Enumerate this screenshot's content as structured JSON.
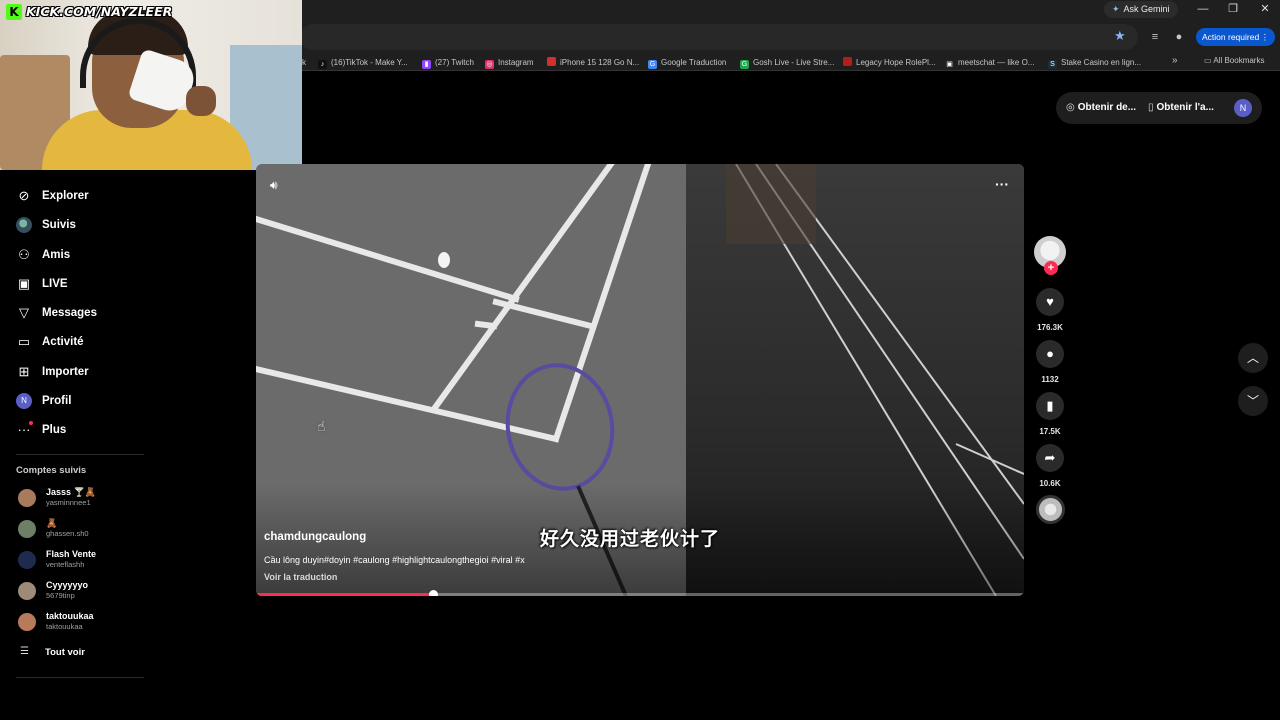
{
  "browser": {
    "gemini_label": "Ask Gemini",
    "action_required": "Action required",
    "bookmarks": [
      {
        "label": "k",
        "color": "#444444",
        "icon": ""
      },
      {
        "label": "(16)TikTok - Make Y...",
        "color": "#111111",
        "icon": "tiktok-icon"
      },
      {
        "label": "(27) Twitch",
        "color": "#9146ff",
        "icon": "twitch-icon"
      },
      {
        "label": "Instagram",
        "color": "#e1306c",
        "icon": "instagram-icon"
      },
      {
        "label": "iPhone 15 128 Go N...",
        "color": "#d32f2f",
        "icon": "apple-icon"
      },
      {
        "label": "Google Traduction",
        "color": "#4285f4",
        "icon": "translate-icon"
      },
      {
        "label": "Gosh Live - Live Stre...",
        "color": "#1ea84b",
        "icon": "gosh-icon"
      },
      {
        "label": "Legacy Hope RolePl...",
        "color": "#b71c1c",
        "icon": "legacy-icon"
      },
      {
        "label": "meetschat — like O...",
        "color": "#222222",
        "icon": "meetschat-icon"
      },
      {
        "label": "Stake Casino en lign...",
        "color": "#1a2c38",
        "icon": "stake-icon"
      }
    ],
    "all_bookmarks": "All Bookmarks"
  },
  "webcam": {
    "overlay_text": "KICK.COM/NAYZLEER"
  },
  "topbar": {
    "get_coins": "Obtenir de...",
    "get_app": "Obtenir l'a...",
    "avatar_letter": "N"
  },
  "sidebar": {
    "items": [
      {
        "label": "Explorer",
        "icon": "compass-icon"
      },
      {
        "label": "Suivis",
        "icon": "avatar-icon"
      },
      {
        "label": "Amis",
        "icon": "friends-icon"
      },
      {
        "label": "LIVE",
        "icon": "live-icon"
      },
      {
        "label": "Messages",
        "icon": "messages-icon"
      },
      {
        "label": "Activité",
        "icon": "activity-icon"
      },
      {
        "label": "Importer",
        "icon": "upload-icon"
      },
      {
        "label": "Profil",
        "icon": "profile-icon",
        "avatar_letter": "N"
      },
      {
        "label": "Plus",
        "icon": "more-icon"
      }
    ],
    "following_title": "Comptes suivis",
    "following": [
      {
        "name": "Jasss 🍸🧸",
        "handle": "yasminnnee1",
        "color": "#a87b5d"
      },
      {
        "name": "🧸",
        "handle": "ghassen.sh0",
        "color": "#6d7f67"
      },
      {
        "name": "Flash Vente",
        "handle": "venteflashh",
        "color": "#1e2b4f"
      },
      {
        "name": "Cyyyyyyo",
        "handle": "5679tinp",
        "color": "#9d8a79"
      },
      {
        "name": "taktouukaa",
        "handle": "taktouukaa",
        "color": "#b77a5a"
      }
    ],
    "see_all": "Tout voir"
  },
  "video": {
    "author": "chamdungcaulong",
    "description": "Cầu lông duyin#doyin #caulong #highlightcaulongthegioi #viral #x",
    "translate": "Voir la traduction",
    "subtitle": "好久没用过老伙计了",
    "progress": 0.23
  },
  "actions": {
    "likes": "176.3K",
    "comments": "1132",
    "saves": "17.5K",
    "shares": "10.6K"
  }
}
